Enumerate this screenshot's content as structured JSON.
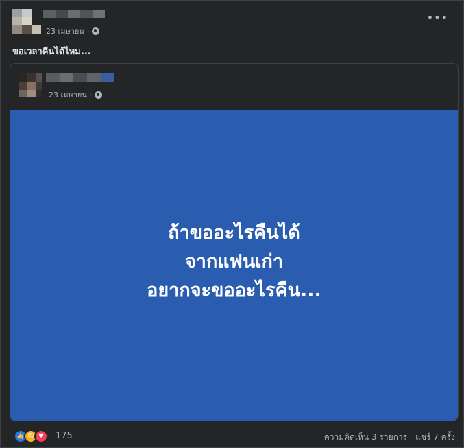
{
  "post": {
    "date": "23 เมษายน",
    "caption": "ขอเวลาคืนได้ไหม..."
  },
  "shared_post": {
    "date": "23 เมษายน",
    "text_lines": [
      "ถ้าขออะไรคืนได้",
      "จากแฟนเก่า",
      "อยากจะขออะไรคืน..."
    ],
    "background": "#2a5db0"
  },
  "footer": {
    "reaction_count": "175",
    "comments": "ความคิดเห็น 3 รายการ",
    "shares": "แชร์ 7 ครั้ง"
  },
  "icons": {
    "privacy": "globe-icon",
    "more": "more-options-icon",
    "reactions": [
      "like-icon",
      "care-icon",
      "love-icon"
    ]
  },
  "colors": {
    "background": "#242526",
    "text": "#e4e6eb",
    "muted": "#b0b3b8",
    "like": "#2078f4",
    "care": "#f7b125",
    "love": "#f33e58"
  }
}
